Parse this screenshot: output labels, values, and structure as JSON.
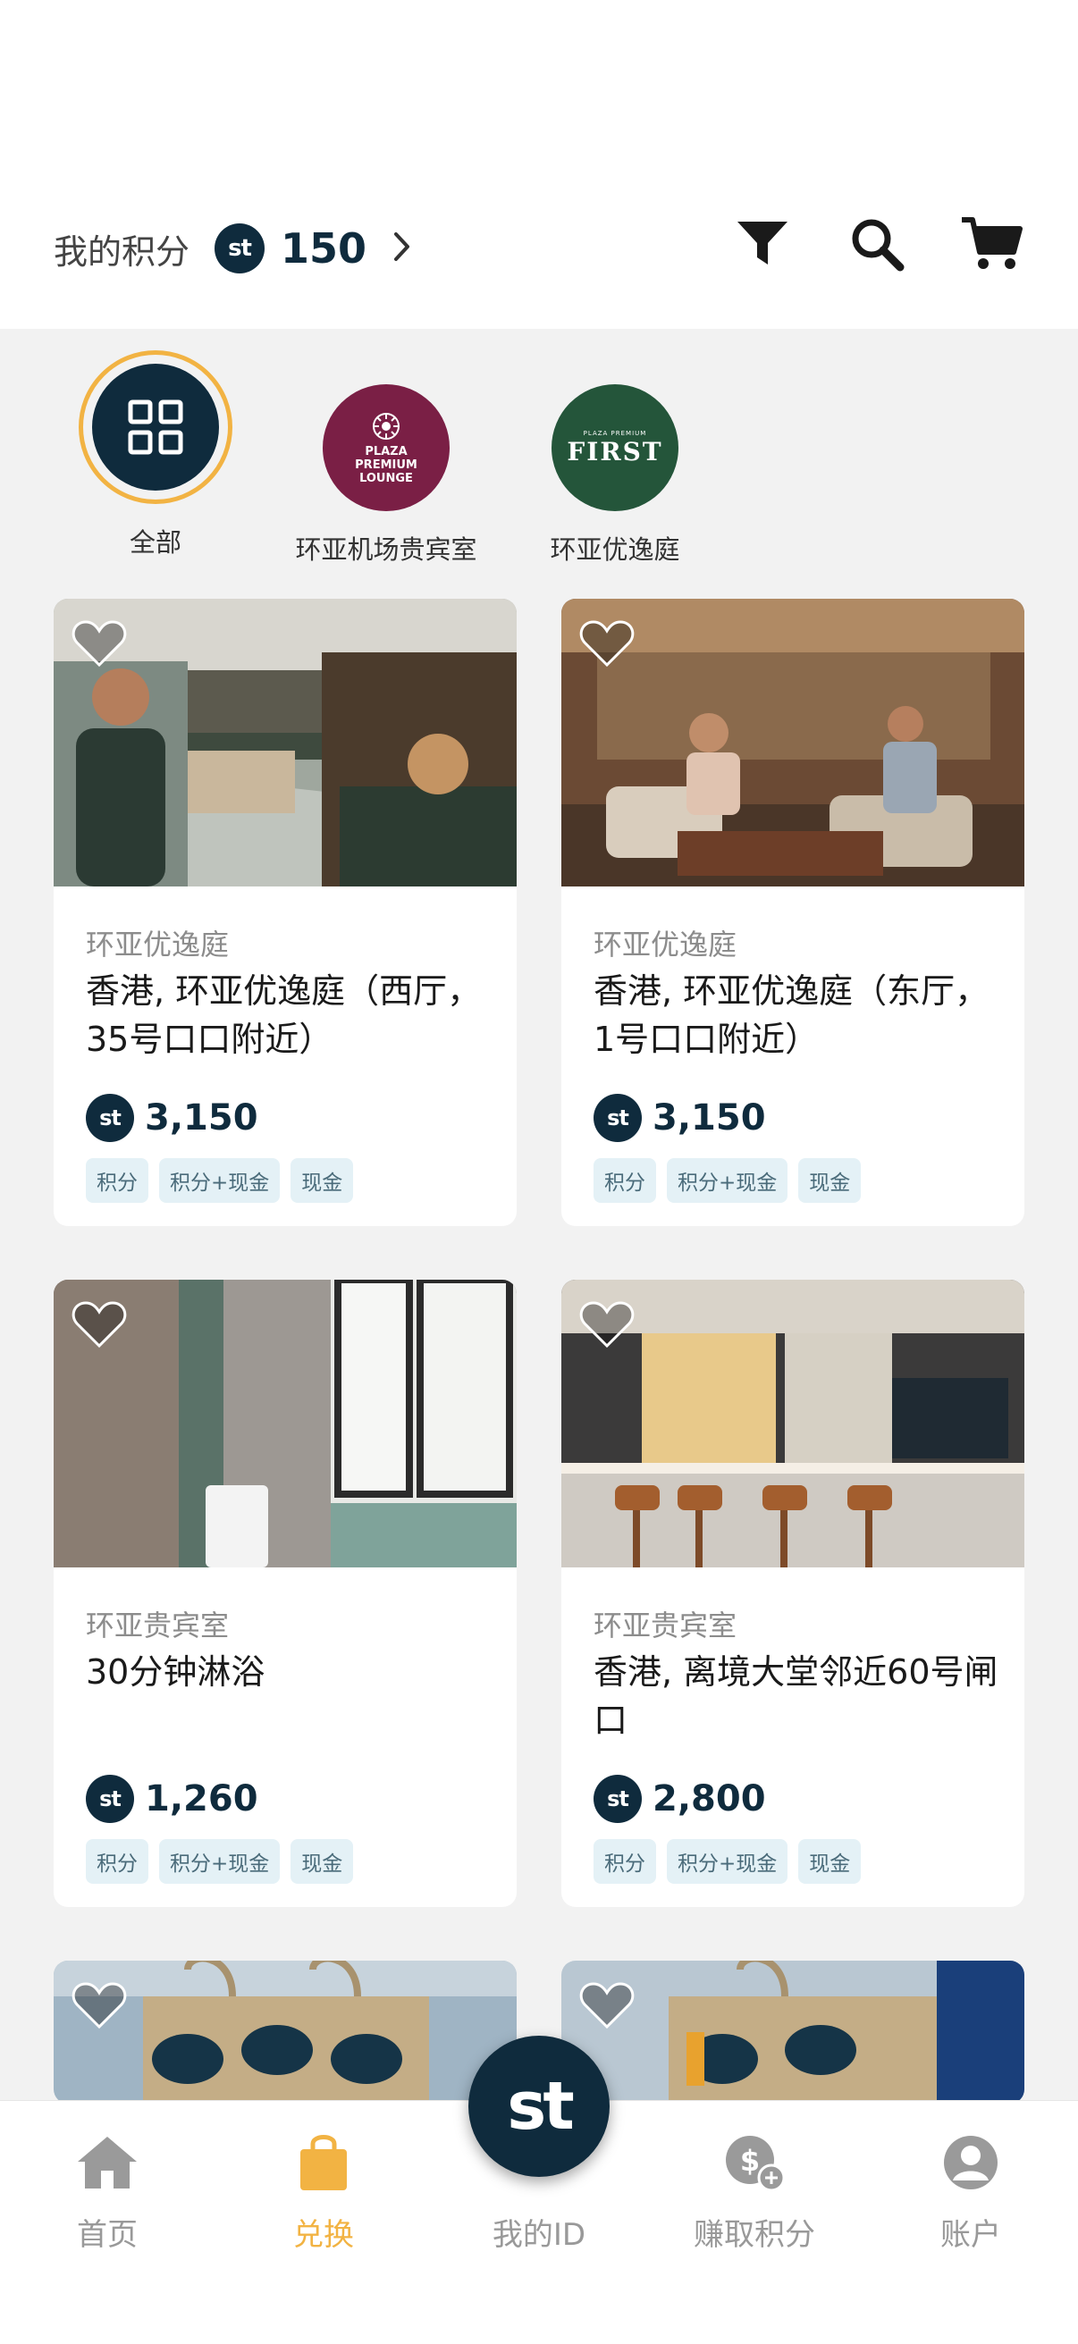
{
  "header": {
    "points_label": "我的积分",
    "points_value": "150",
    "st_logo": "st"
  },
  "icons": {
    "filter": "filter-icon",
    "search": "search-icon",
    "cart": "cart-icon",
    "heart": "heart-icon"
  },
  "categories": [
    {
      "label": "全部",
      "selected": true
    },
    {
      "label": "环亚机场贵宾室",
      "logo_text": "PLAZA PREMIUM LOUNGE"
    },
    {
      "label": "环亚优逸庭",
      "logo_text": "FIRST",
      "logo_small": "PLAZA PREMIUM"
    }
  ],
  "cards": [
    {
      "brand": "环亚优逸庭",
      "title": "香港, 环亚优逸庭（西厅，35号口口附近）",
      "price": "3,150",
      "tags": [
        "积分",
        "积分+现金",
        "现金"
      ]
    },
    {
      "brand": "环亚优逸庭",
      "title": "香港, 环亚优逸庭（东厅，1号口口附近）",
      "price": "3,150",
      "tags": [
        "积分",
        "积分+现金",
        "现金"
      ]
    },
    {
      "brand": "环亚贵宾室",
      "title": "30分钟淋浴",
      "price": "1,260",
      "tags": [
        "积分",
        "积分+现金",
        "现金"
      ]
    },
    {
      "brand": "环亚贵宾室",
      "title": "香港, 离境大堂邻近60号闸口",
      "price": "2,800",
      "tags": [
        "积分",
        "积分+现金",
        "现金"
      ]
    }
  ],
  "nav": [
    {
      "label": "首页",
      "icon": "home-icon"
    },
    {
      "label": "兑换",
      "icon": "shopping-bag-icon",
      "active": true
    },
    {
      "label": "我的ID",
      "icon": "st-logo"
    },
    {
      "label": "赚取积分",
      "icon": "earn-points-icon"
    },
    {
      "label": "账户",
      "icon": "account-icon"
    }
  ],
  "colors": {
    "brand_navy": "#0f2b3d",
    "accent_gold": "#f2b343",
    "ppl_burgundy": "#7a1f45",
    "first_green": "#24553a",
    "tag_bg": "#e4f1f6"
  }
}
